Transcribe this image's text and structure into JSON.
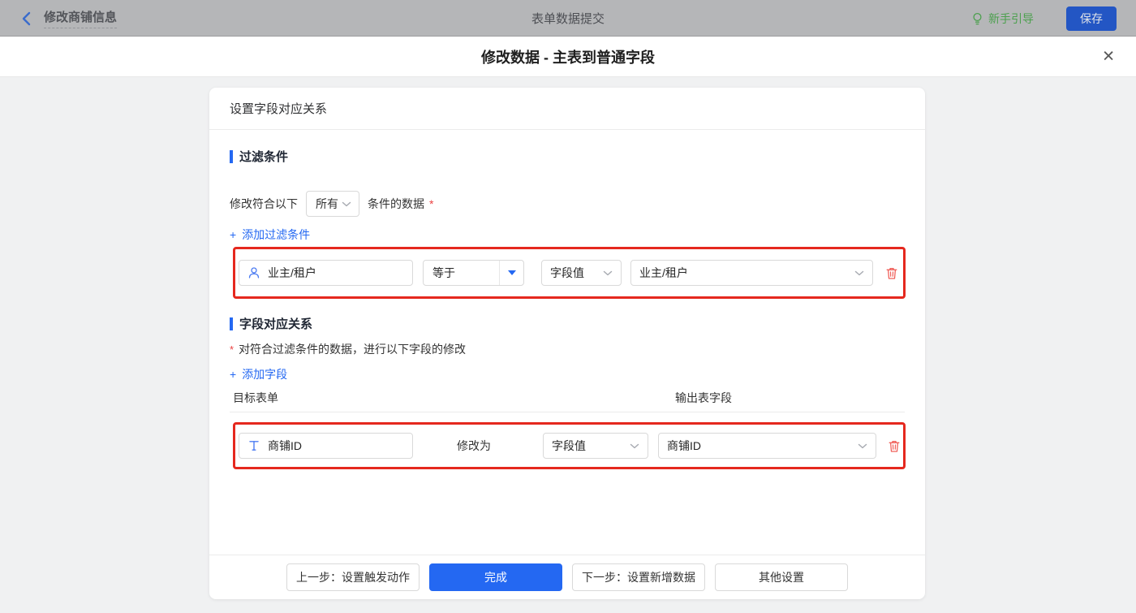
{
  "topbar": {
    "back_title": "修改商铺信息",
    "center_title": "表单数据提交",
    "guide_label": "新手引导",
    "save_label": "保存"
  },
  "modal": {
    "title": "修改数据 - 主表到普通字段",
    "close_glyph": "✕",
    "card": {
      "header": "设置字段对应关系",
      "filter": {
        "section_title": "过滤条件",
        "sentence_prefix": "修改符合以下",
        "match_mode_value": "所有",
        "sentence_suffix": "条件的数据",
        "required_mark": "*",
        "add_plus": "+",
        "add_label": "添加过滤条件",
        "row": {
          "field_name": "业主/租户",
          "operator": "等于",
          "value_type": "字段值",
          "value_field": "业主/租户"
        }
      },
      "mapping": {
        "section_title": "字段对应关系",
        "required_mark": "*",
        "description": "对符合过滤条件的数据，进行以下字段的修改",
        "add_plus": "+",
        "add_label": "添加字段",
        "columns": {
          "target": "目标表单",
          "output": "输出表字段"
        },
        "row": {
          "field_name": "商铺ID",
          "action_label": "修改为",
          "value_type": "字段值",
          "value_field": "商铺ID"
        }
      },
      "footer": {
        "prev": "上一步：设置触发动作",
        "done": "完成",
        "next": "下一步：设置新增数据",
        "other": "其他设置"
      }
    }
  },
  "icons": {
    "back": "chevron-left",
    "guide": "lightbulb",
    "close": "close-x",
    "filter_field": "user",
    "mapping_field": "text-T",
    "select_caret": "chevron-down",
    "operator_caret": "triangle-down",
    "delete": "trash",
    "section_marker": "blue-bar"
  },
  "colors": {
    "accent_blue": "#2468f2",
    "highlight_red": "#e5281e",
    "trash_red": "#f0605a",
    "guide_green": "#4ca04e",
    "save_btn_blue_dimmed": "#2356c4",
    "topbar_bg_dimmed": "#b5b6b8",
    "page_bg": "#f0f1f2",
    "input_border": "#d9d9d9",
    "divider": "#ebebeb",
    "required_red": "#eb4141"
  }
}
